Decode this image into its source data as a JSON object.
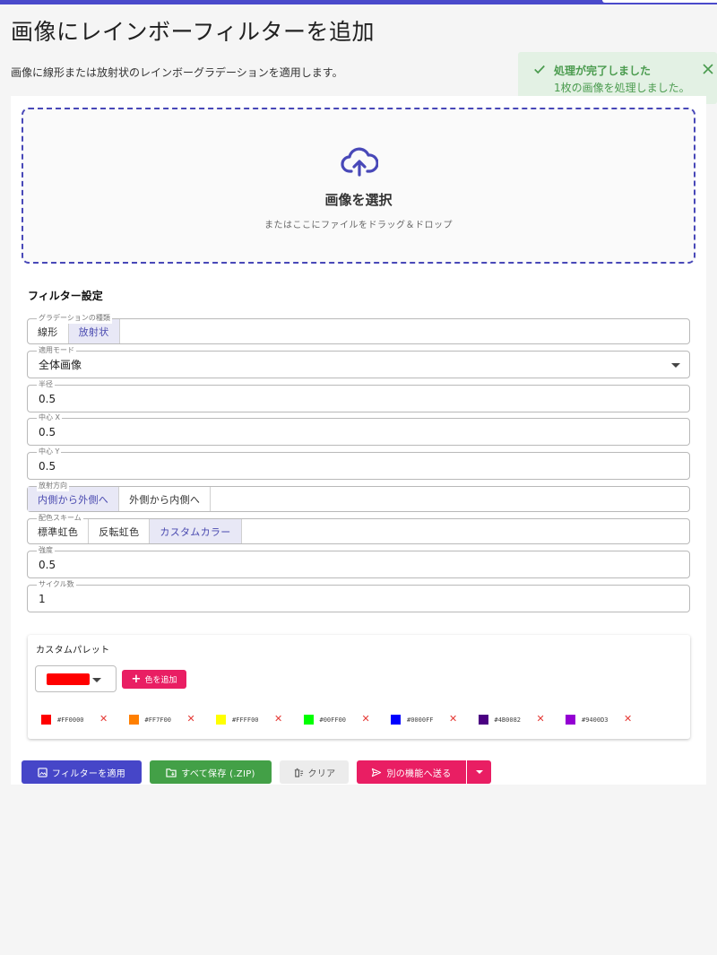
{
  "page": {
    "title": "画像にレインボーフィルターを追加",
    "description": "画像に線形または放射状のレインボーグラデーションを適用します。"
  },
  "toast": {
    "title": "処理が完了しました",
    "message": "1枚の画像を処理しました。",
    "color": "#4a9b4e"
  },
  "dropzone": {
    "title": "画像を選択",
    "subtitle": "またはここにファイルをドラッグ＆ドロップ",
    "icon": "cloud-upload-icon"
  },
  "settings": {
    "title": "フィルター設定",
    "gradient_type": {
      "label": "グラデーションの種類",
      "options": [
        "線形",
        "放射状"
      ],
      "selected": "放射状"
    },
    "apply_mode": {
      "label": "適用モード",
      "value": "全体画像"
    },
    "radius": {
      "label": "半径",
      "value": "0.5"
    },
    "center_x": {
      "label": "中心 X",
      "value": "0.5"
    },
    "center_y": {
      "label": "中心 Y",
      "value": "0.5"
    },
    "radial_direction": {
      "label": "放射方向",
      "options": [
        "内側から外側へ",
        "外側から内側へ"
      ],
      "selected": "内側から外側へ"
    },
    "color_scheme": {
      "label": "配色スキーム",
      "options": [
        "標準虹色",
        "反転虹色",
        "カスタムカラー"
      ],
      "selected": "カスタムカラー"
    },
    "intensity": {
      "label": "強度",
      "value": "0.5"
    },
    "cycles": {
      "label": "サイクル数",
      "value": "1"
    }
  },
  "palette": {
    "title": "カスタムパレット",
    "selected_color": "#FF0000",
    "add_label": "色を追加",
    "colors": [
      {
        "hex": "#FF0000"
      },
      {
        "hex": "#FF7F00"
      },
      {
        "hex": "#FFFF00"
      },
      {
        "hex": "#00FF00"
      },
      {
        "hex": "#0000FF"
      },
      {
        "hex": "#4B0082"
      },
      {
        "hex": "#9400D3"
      }
    ]
  },
  "actions": {
    "apply_label": "フィルターを適用",
    "save_label": "すべて保存 (.ZIP)",
    "clear_label": "クリア",
    "send_label": "別の機能へ送る"
  }
}
